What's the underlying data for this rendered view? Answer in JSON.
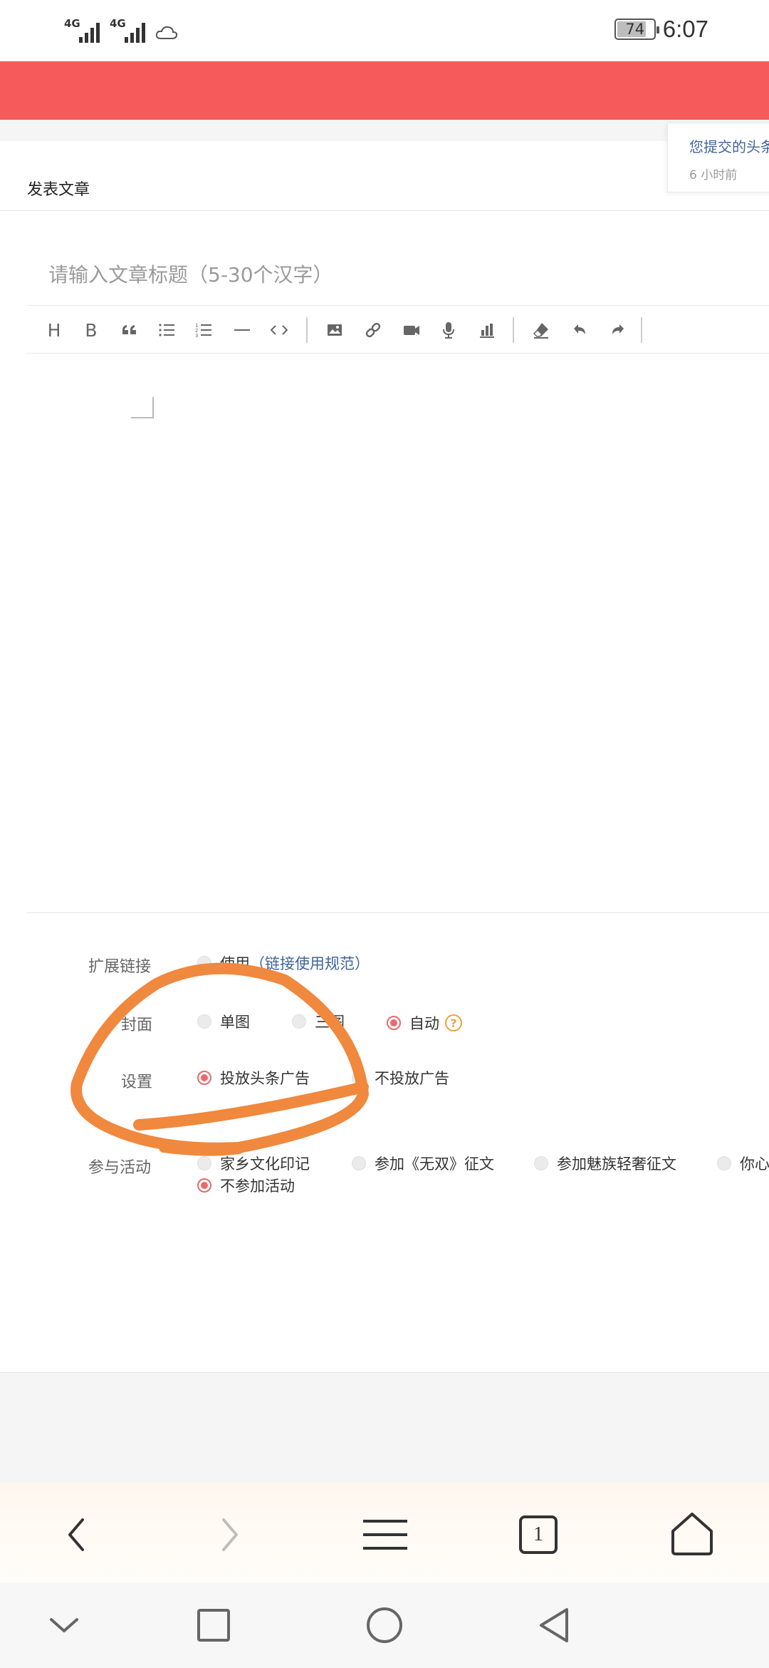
{
  "status_bar": {
    "network_1": "4G",
    "network_2": "4G",
    "battery_level": "74",
    "time": "6:07",
    "weather_icon": "cloud-icon"
  },
  "notification": {
    "title": "您提交的头条",
    "time": "6 小时前"
  },
  "page": {
    "title": "发表文章"
  },
  "editor": {
    "title_placeholder": "请输入文章标题（5-30个汉字）",
    "toolbar": [
      "heading-icon",
      "bold-icon",
      "quote-icon",
      "unordered-list-icon",
      "ordered-list-icon",
      "horizontal-rule-icon",
      "code-icon",
      "image-icon",
      "link-icon",
      "video-icon",
      "audio-icon",
      "chart-icon",
      "eraser-icon",
      "undo-icon",
      "redo-icon"
    ],
    "toolbar_heading": "H",
    "toolbar_bold": "B"
  },
  "settings": {
    "ext_link": {
      "label": "扩展链接",
      "option_use": "使用",
      "option_link": "（链接使用规范）"
    },
    "cover": {
      "label": "封面",
      "options": [
        "单图",
        "三图",
        "自动"
      ],
      "selected": "自动"
    },
    "ad": {
      "label": "设置",
      "options": [
        "投放头条广告",
        "不投放广告"
      ],
      "selected": "投放头条广告"
    },
    "activity": {
      "label": "参与活动",
      "options": [
        "家乡文化印记",
        "参加《无双》征文",
        "参加魅族轻奢征文",
        "你心",
        "不参加活动"
      ],
      "selected": "不参加活动"
    }
  },
  "browser_nav": {
    "tab_count": "1",
    "icons": [
      "back-icon",
      "forward-icon",
      "menu-icon",
      "tabs-icon",
      "home-icon"
    ]
  },
  "system_nav": {
    "icons": [
      "collapse-icon",
      "recent-apps-icon",
      "home-circle-icon",
      "back-triangle-icon"
    ]
  },
  "colors": {
    "header_red": "#f65a5a",
    "link_blue": "#406599",
    "radio_red": "#e86a6a",
    "annotation_orange": "#f0883e"
  }
}
